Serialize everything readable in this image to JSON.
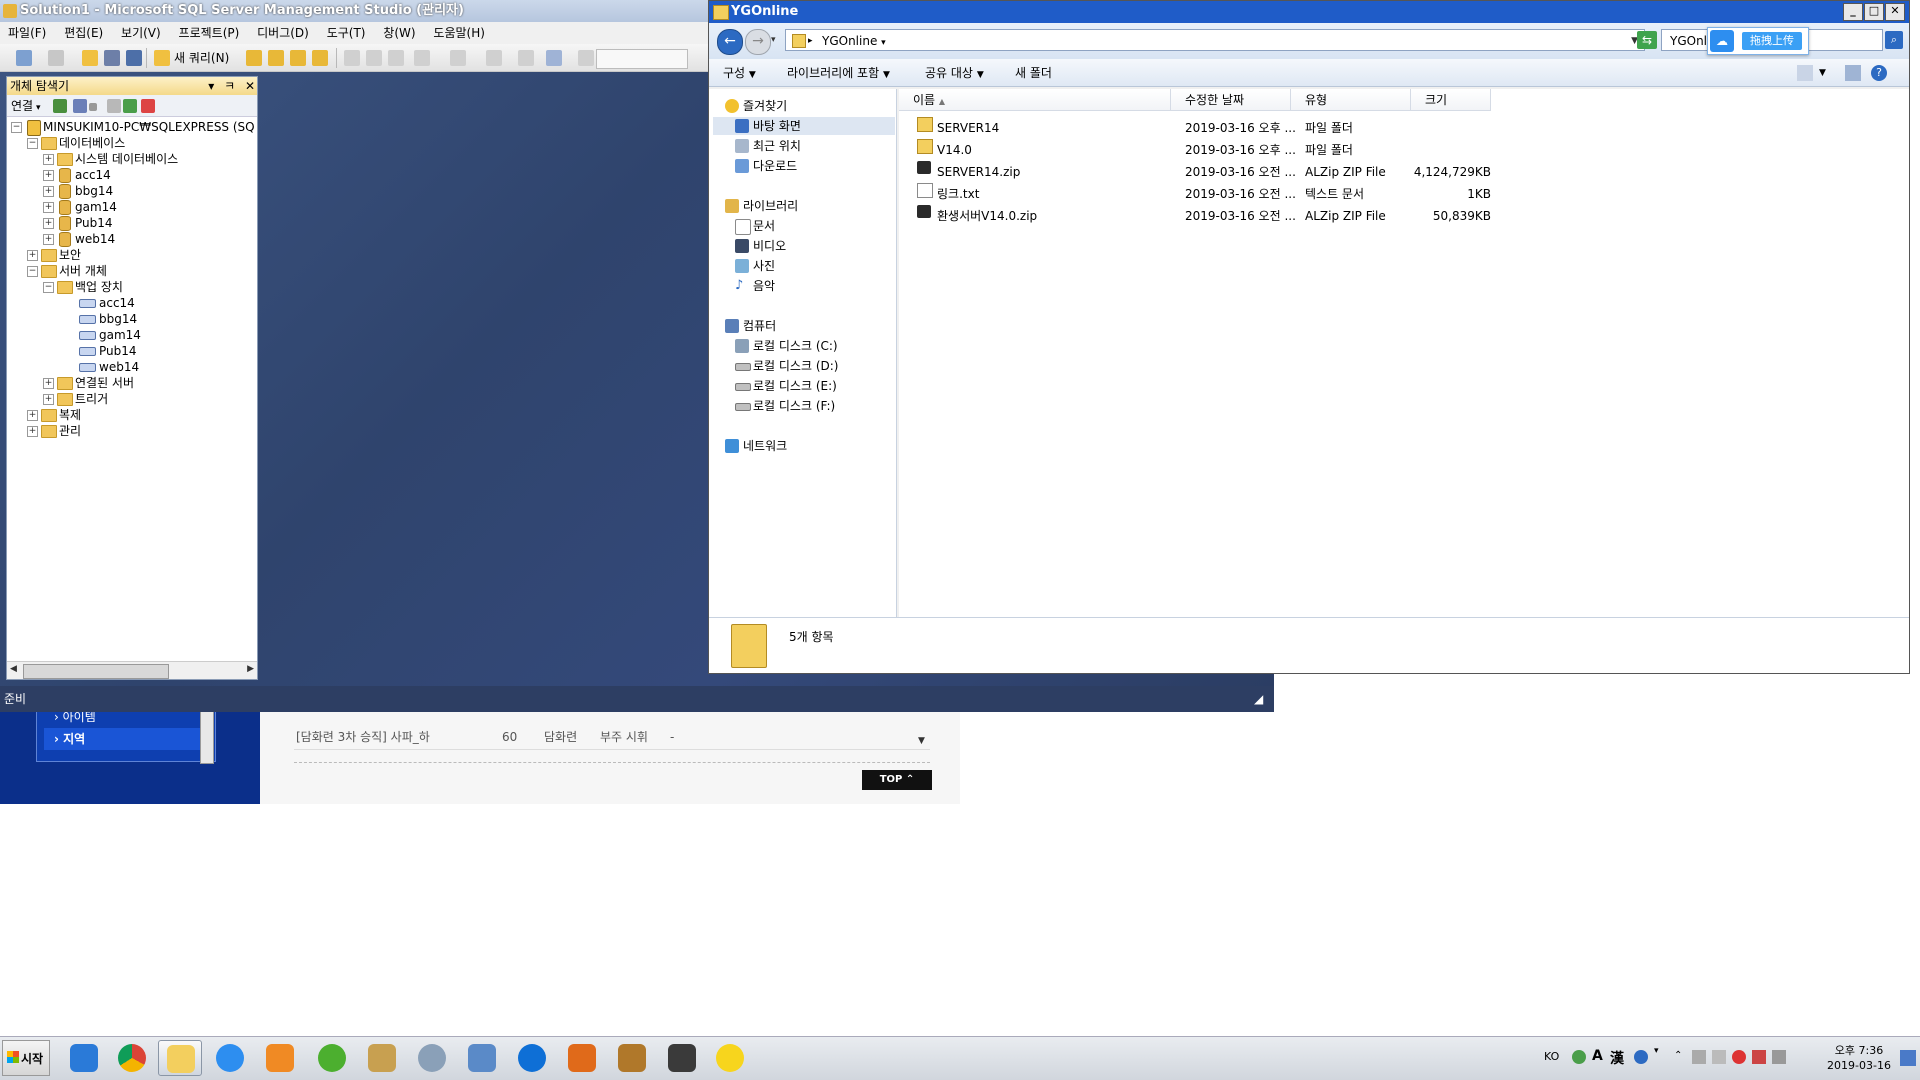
{
  "ssms": {
    "title": "Solution1 - Microsoft SQL Server Management Studio (관리자)",
    "menu": [
      "파일(F)",
      "편집(E)",
      "보기(V)",
      "프로젝트(P)",
      "디버그(D)",
      "도구(T)",
      "창(W)",
      "도움말(H)"
    ],
    "new_query_label": "새 쿼리(N)",
    "status": "준비",
    "object_explorer": {
      "title": "개체 탐색기",
      "pin": "ㅋ",
      "connect_label": "연결",
      "server": "MINSUKIM10-PC₩SQLEXPRESS (SQ",
      "nodes": {
        "databases": "데이터베이스",
        "system_databases": "시스템 데이터베이스",
        "db_acc14": "acc14",
        "db_bbg14": "bbg14",
        "db_gam14": "gam14",
        "db_pub14": "Pub14",
        "db_web14": "web14",
        "security": "보안",
        "server_objects": "서버 개체",
        "backup_devices": "백업 장치",
        "bk_acc14": "acc14",
        "bk_bbg14": "bbg14",
        "bk_gam14": "gam14",
        "bk_pub14": "Pub14",
        "bk_web14": "web14",
        "linked_servers": "연결된 서버",
        "triggers": "트리거",
        "replication": "복제",
        "management": "관리"
      }
    }
  },
  "explorer": {
    "title": "YGOnline",
    "address": "YGOnline",
    "search_value": "YGOnli",
    "upload_label": "拖拽上传",
    "commands": [
      "구성",
      "라이브러리에 포함",
      "공유 대상",
      "새 폴더"
    ],
    "nav": {
      "favorites": "즐겨찾기",
      "desktop": "바탕 화면",
      "recent": "최근 위치",
      "downloads": "다운로드",
      "libraries": "라이브러리",
      "documents": "문서",
      "videos": "비디오",
      "pictures": "사진",
      "music": "음악",
      "computer": "컴퓨터",
      "drive_c": "로컬 디스크 (C:)",
      "drive_d": "로컬 디스크 (D:)",
      "drive_e": "로컬 디스크 (E:)",
      "drive_f": "로컬 디스크 (F:)",
      "network": "네트워크"
    },
    "columns": {
      "name": "이름",
      "modified": "수정한 날짜",
      "type": "유형",
      "size": "크기"
    },
    "files": [
      {
        "name": "SERVER14",
        "modified": "2019-03-16 오후 ...",
        "type": "파일 폴더",
        "size": "",
        "icon": "folder-icon"
      },
      {
        "name": "V14.0",
        "modified": "2019-03-16 오후 ...",
        "type": "파일 폴더",
        "size": "",
        "icon": "folder-icon"
      },
      {
        "name": "SERVER14.zip",
        "modified": "2019-03-16 오전 ...",
        "type": "ALZip ZIP File",
        "size": "4,124,729KB",
        "icon": "zip-icon"
      },
      {
        "name": "링크.txt",
        "modified": "2019-03-16 오전 ...",
        "type": "텍스트 문서",
        "size": "1KB",
        "icon": "text-file-icon"
      },
      {
        "name": "환생서버V14.0.zip",
        "modified": "2019-03-16 오전 ...",
        "type": "ALZip ZIP File",
        "size": "50,839KB",
        "icon": "zip-icon"
      }
    ],
    "item_count": "5개 항목"
  },
  "web": {
    "nav_item_1": "› 아이템",
    "nav_item_2": "› 지역",
    "row": {
      "name": "[담화련 3차 승직] 사파_하",
      "level": "60",
      "location": "담화련",
      "npc": "부주 시휘",
      "extra": "-"
    },
    "top_button": "TOP ⌃"
  },
  "taskbar": {
    "start_label": "시작",
    "lang": "KO",
    "ime_a": "A",
    "ime_han": "漢",
    "time": "오후 7:36",
    "date": "2019-03-16"
  },
  "colors": {
    "ssms_background": "#2f4166",
    "explorer_title": "#1f5cc8",
    "web_nav": "#0b2f8a"
  }
}
